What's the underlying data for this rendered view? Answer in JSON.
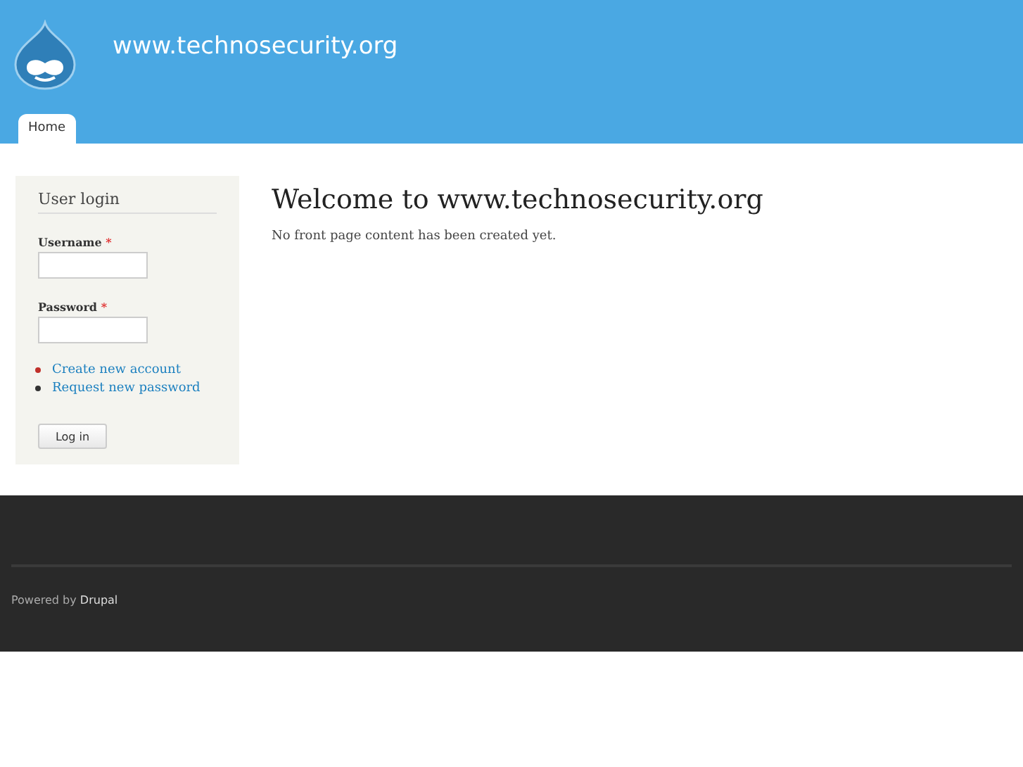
{
  "site": {
    "name": "www.technosecurity.org"
  },
  "tabs": [
    {
      "label": "Home",
      "selected": true
    }
  ],
  "login": {
    "title": "User login",
    "fields": [
      {
        "label": "Username",
        "required_mark": "*"
      },
      {
        "label": "Password",
        "required_mark": "*"
      }
    ],
    "links": [
      {
        "label": "Create new account",
        "color": "#c0302a"
      },
      {
        "label": "Request new password",
        "color": "#333333"
      }
    ],
    "button": "Log in"
  },
  "main": {
    "title": "Welcome to www.technosecurity.org",
    "text": "No front page content has been created yet."
  },
  "footer": {
    "prefix": "Powered by",
    "link": "Drupal"
  }
}
